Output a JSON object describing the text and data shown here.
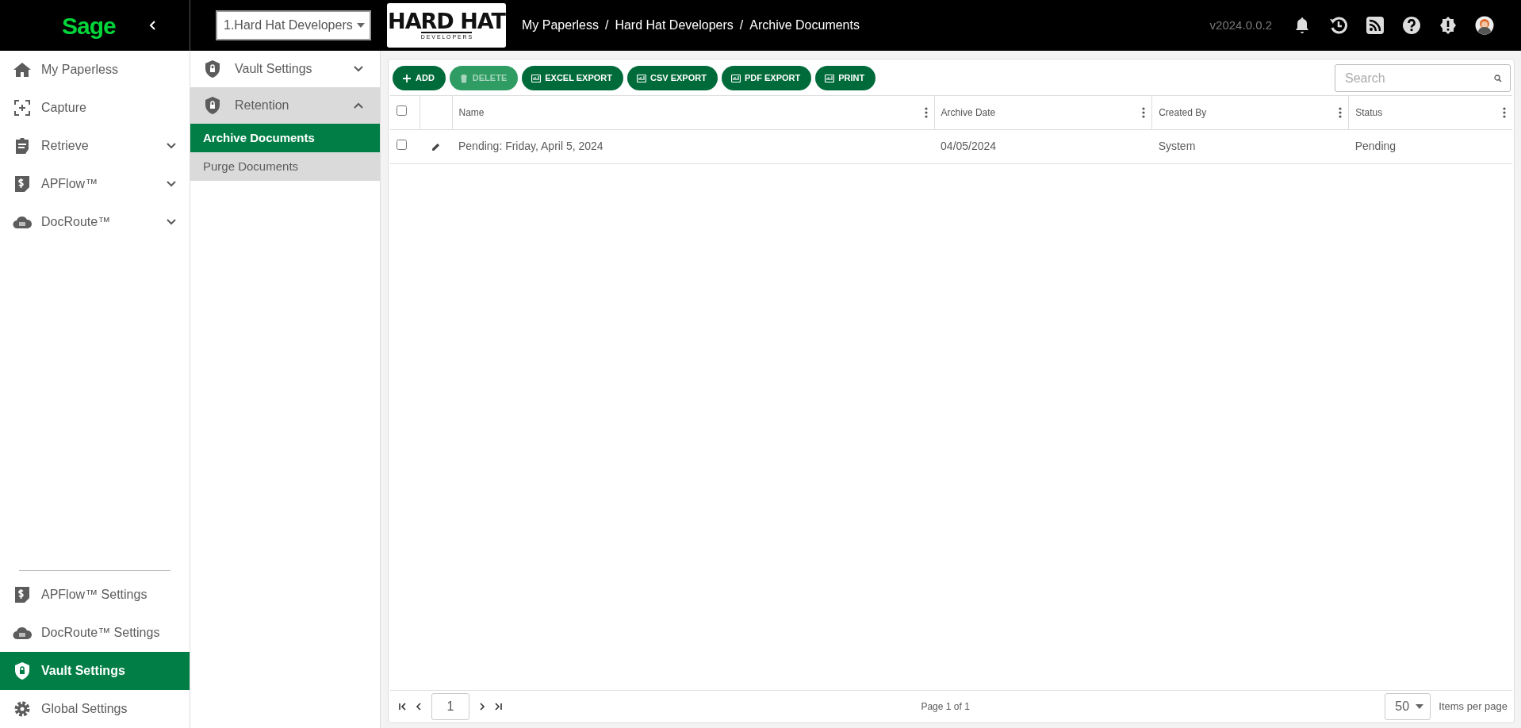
{
  "top_bar": {
    "brand": "Sage",
    "company_select": {
      "value": "1.Hard Hat Developers"
    },
    "logo": {
      "line1": "HARD HAT",
      "line2": "D E V E L O P E R S"
    },
    "breadcrumb": {
      "separator": "/",
      "items": [
        "My Paperless",
        "Hard Hat Developers",
        "Archive Documents"
      ]
    },
    "version": "v2024.0.0.2",
    "actions": [
      {
        "kind": "bell"
      },
      {
        "kind": "history"
      },
      {
        "kind": "rss"
      },
      {
        "kind": "help"
      },
      {
        "kind": "alert"
      },
      {
        "kind": "avatar"
      }
    ]
  },
  "sidebar": {
    "items": [
      {
        "kind": "home",
        "label": "My Paperless",
        "expandable": false,
        "selected": false
      },
      {
        "kind": "capture",
        "label": "Capture",
        "expandable": false,
        "selected": false
      },
      {
        "kind": "retrieve",
        "label": "Retrieve",
        "expandable": true,
        "selected": false
      },
      {
        "kind": "dollar",
        "label": "APFlow™",
        "expandable": true,
        "selected": false
      },
      {
        "kind": "cloud",
        "label": "DocRoute™",
        "expandable": true,
        "selected": false
      }
    ],
    "bottom_items": [
      {
        "kind": "dollar",
        "label": "APFlow™ Settings",
        "selected": false
      },
      {
        "kind": "cloud",
        "label": "DocRoute™ Settings",
        "selected": false
      },
      {
        "kind": "shield",
        "label": "Vault Settings",
        "selected": true
      },
      {
        "kind": "gear",
        "label": "Global Settings",
        "selected": false
      }
    ]
  },
  "subnav": {
    "groups": [
      {
        "label": "Vault Settings",
        "expanded": false
      },
      {
        "label": "Retention",
        "expanded": true,
        "children": [
          {
            "label": "Archive Documents",
            "selected": true
          },
          {
            "label": "Purge Documents",
            "selected": false
          }
        ]
      }
    ]
  },
  "toolbar": {
    "buttons": [
      {
        "kind": "plus",
        "label": "ADD",
        "disabled": false
      },
      {
        "kind": "trash",
        "label": "DELETE",
        "disabled": true
      },
      {
        "kind": "export",
        "label": "EXCEL EXPORT",
        "disabled": false
      },
      {
        "kind": "export",
        "label": "CSV EXPORT",
        "disabled": false
      },
      {
        "kind": "export",
        "label": "PDF EXPORT",
        "disabled": false
      },
      {
        "kind": "export",
        "label": "PRINT",
        "disabled": false
      }
    ],
    "search": {
      "placeholder": "Search"
    }
  },
  "table": {
    "all_checked": false,
    "columns": [
      "Name",
      "Archive Date",
      "Created By",
      "Status"
    ],
    "rows": [
      {
        "checked": false,
        "cells": [
          "Pending: Friday, April 5, 2024",
          "04/05/2024",
          "System",
          "Pending"
        ]
      }
    ]
  },
  "pagination": {
    "page": "1",
    "info": "Page 1 of 1",
    "page_size": "50",
    "page_size_label": "Items per page"
  }
}
